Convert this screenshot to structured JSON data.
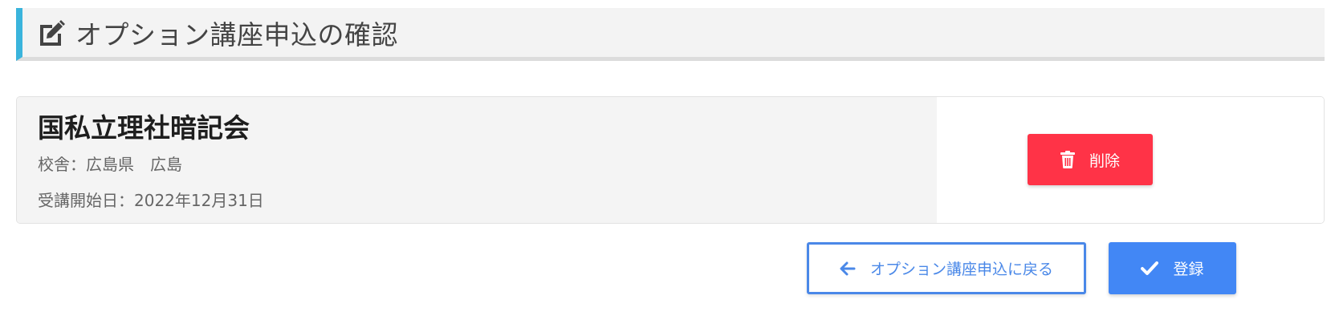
{
  "header": {
    "icon": "edit-icon",
    "title": "オプション講座申込の確認",
    "accent_color": "#3ab4dc"
  },
  "course": {
    "name": "国私立理社暗記会",
    "campus": "校舎：広島県　広島",
    "start_date": "受講開始日：2022年12月31日",
    "delete_label": "削除",
    "delete_icon": "trash-icon",
    "delete_color": "#ff3347"
  },
  "actions": {
    "back_label": "オプション講座申込に戻る",
    "back_icon": "arrow-left-icon",
    "register_label": "登録",
    "register_icon": "check-icon",
    "primary_color": "#4287f5"
  }
}
